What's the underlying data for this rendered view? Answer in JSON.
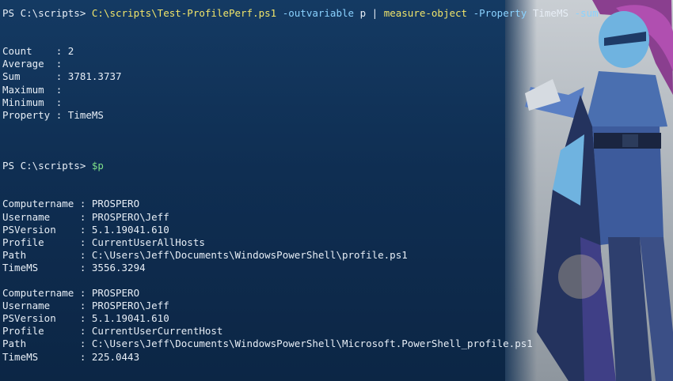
{
  "terminal": {
    "prompt": "PS C:\\scripts> ",
    "command": {
      "script": "C:\\scripts\\Test-ProfilePerf.ps1",
      "param1": "-outvariable",
      "arg1": "p",
      "pipe": "|",
      "cmdlet": "measure-object",
      "param2": "-Property",
      "arg2": "TimeMS",
      "param3": "-sum"
    },
    "measure": {
      "count_label": "Count    :",
      "count_value": "2",
      "average_label": "Average  :",
      "sum_label": "Sum      :",
      "sum_value": "3781.3737",
      "maximum_label": "Maximum  :",
      "minimum_label": "Minimum  :",
      "property_label": "Property :",
      "property_value": "TimeMS"
    },
    "command2": "$p",
    "records": [
      {
        "computername_label": "Computername :",
        "computername": "PROSPERO",
        "username_label": "Username     :",
        "username": "PROSPERO\\Jeff",
        "psversion_label": "PSVersion    :",
        "psversion": "5.1.19041.610",
        "profile_label": "Profile      :",
        "profile": "CurrentUserAllHosts",
        "path_label": "Path         :",
        "path": "C:\\Users\\Jeff\\Documents\\WindowsPowerShell\\profile.ps1",
        "timems_label": "TimeMS       :",
        "timems": "3556.3294"
      },
      {
        "computername_label": "Computername :",
        "computername": "PROSPERO",
        "username_label": "Username     :",
        "username": "PROSPERO\\Jeff",
        "psversion_label": "PSVersion    :",
        "psversion": "5.1.19041.610",
        "profile_label": "Profile      :",
        "profile": "CurrentUserCurrentHost",
        "path_label": "Path         :",
        "path": "C:\\Users\\Jeff\\Documents\\WindowsPowerShell\\Microsoft.PowerShell_profile.ps1",
        "timems_label": "TimeMS       :",
        "timems": "225.0443"
      }
    ]
  },
  "colors": {
    "background": "#0f2e52",
    "text": "#e7eef6",
    "command": "#f1e56a",
    "parameter": "#8ad2ff",
    "variable": "#7fe08a"
  },
  "background_image": "character-illustration"
}
